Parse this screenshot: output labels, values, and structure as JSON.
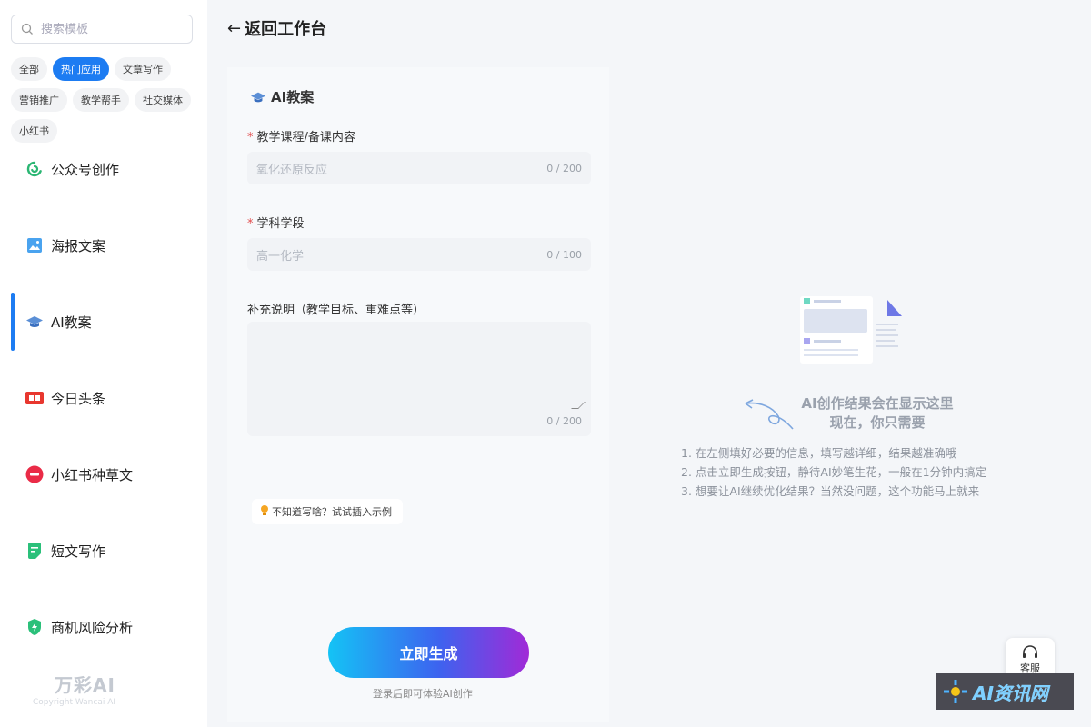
{
  "sidebar": {
    "search_placeholder": "搜索模板",
    "chips": [
      "全部",
      "热门应用",
      "文章写作",
      "营销推广",
      "教学帮手",
      "社交媒体",
      "小红书"
    ],
    "active_chip": 1,
    "items": [
      {
        "label": "公众号创作",
        "icon": "wechat-icon"
      },
      {
        "label": "海报文案",
        "icon": "poster-icon"
      },
      {
        "label": "AI教案",
        "icon": "graduation-cap-icon"
      },
      {
        "label": "今日头条",
        "icon": "toutiao-icon"
      },
      {
        "label": "小红书种草文",
        "icon": "xiaohongshu-icon"
      },
      {
        "label": "短文写作",
        "icon": "document-icon"
      },
      {
        "label": "商机风险分析",
        "icon": "shield-icon"
      }
    ],
    "active_item": 2,
    "logo": "万彩AI",
    "logo_sub": "Copyright Wancai AI"
  },
  "header": {
    "back_label": "返回工作台"
  },
  "form": {
    "title": "AI教案",
    "fields": [
      {
        "label": "教学课程/备课内容",
        "required": true,
        "placeholder": "氧化还原反应",
        "counter": "0 / 200"
      },
      {
        "label": "学科学段",
        "required": true,
        "placeholder": "高一化学",
        "counter": "0 / 100"
      },
      {
        "label": "补充说明（教学目标、重难点等）",
        "required": false,
        "placeholder": "",
        "counter": "0 / 200"
      }
    ],
    "hint": "不知道写啥？试试插入示例",
    "generate_button": "立即生成",
    "login_hint": "登录后即可体验AI创作"
  },
  "result": {
    "title_line1": "AI创作结果会在显示这里",
    "title_line2": "现在，你只需要",
    "steps": [
      "1. 在左侧填好必要的信息，填写越详细，结果越准确哦",
      "2. 点击立即生成按钮，静待AI妙笔生花，一般在1分钟内搞定",
      "3. 想要让AI继续优化结果？当然没问题，这个功能马上就来"
    ]
  },
  "service": {
    "label": "客服"
  },
  "watermark": {
    "text": "AI资讯网"
  },
  "colors": {
    "accent": "#1d7cf2",
    "required": "#e24c4c"
  }
}
